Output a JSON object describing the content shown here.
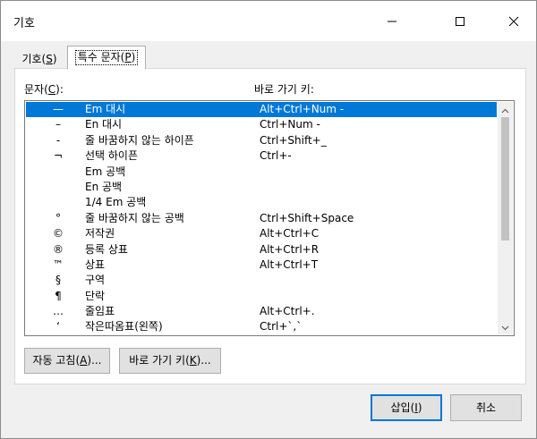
{
  "window": {
    "title": "기호",
    "minimize_icon": "minimize-icon",
    "maximize_icon": "maximize-icon",
    "close_icon": "close-icon"
  },
  "tabs": {
    "symbols": {
      "text": "기호(",
      "key": "S",
      "end": ")"
    },
    "special": {
      "text": "특수 문자(",
      "key": "P",
      "end": ")"
    }
  },
  "columns": {
    "character": {
      "text": "문자(",
      "key": "C",
      "end": "):"
    },
    "shortcut": "바로 가기 키:"
  },
  "rows": [
    {
      "char": "—",
      "name": "Em 대시",
      "key": "Alt+Ctrl+Num -"
    },
    {
      "char": "–",
      "name": "En 대시",
      "key": "Ctrl+Num -"
    },
    {
      "char": "-",
      "name": "줄 바꿈하지 않는 하이픈",
      "key": "Ctrl+Shift+_"
    },
    {
      "char": "¬",
      "name": "선택 하이픈",
      "key": "Ctrl+-"
    },
    {
      "char": "",
      "name": "Em 공백",
      "key": ""
    },
    {
      "char": "",
      "name": "En 공백",
      "key": ""
    },
    {
      "char": "",
      "name": "1/4 Em 공백",
      "key": ""
    },
    {
      "char": "°",
      "name": "줄 바꿈하지 않는 공백",
      "key": "Ctrl+Shift+Space"
    },
    {
      "char": "©",
      "name": "저작권",
      "key": "Alt+Ctrl+C"
    },
    {
      "char": "®",
      "name": "등록 상표",
      "key": "Alt+Ctrl+R"
    },
    {
      "char": "™",
      "name": "상표",
      "key": "Alt+Ctrl+T"
    },
    {
      "char": "§",
      "name": "구역",
      "key": ""
    },
    {
      "char": "¶",
      "name": "단락",
      "key": ""
    },
    {
      "char": "…",
      "name": "줄임표",
      "key": "Alt+Ctrl+."
    },
    {
      "char": "‘",
      "name": "작은따옴표(왼쪽)",
      "key": "Ctrl+`,`"
    }
  ],
  "selected_row": 0,
  "buttons": {
    "autocorrect": {
      "text": "자동 고침(",
      "key": "A",
      "end": ")..."
    },
    "shortcut_key": {
      "text": "바로 가기 키(",
      "key": "K",
      "end": ")..."
    },
    "insert": {
      "text": "삽입(",
      "key": "I",
      "end": ")"
    },
    "cancel": "취소"
  },
  "colors": {
    "selection": "#0078d7",
    "dialog_bg": "#f0f0f0",
    "button_bg": "#e1e1e1"
  }
}
